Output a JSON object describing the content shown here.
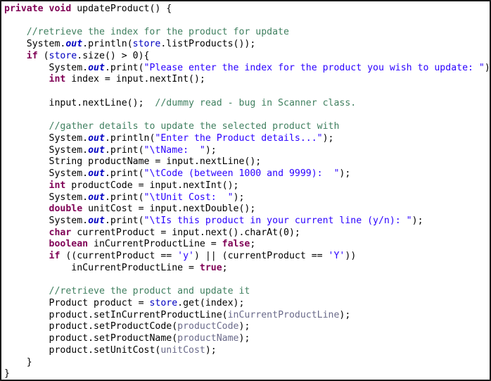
{
  "editor": {
    "title": "Java source code snippet",
    "language": "java",
    "background_color": "#ffffff",
    "border_color": "#1a1a1a",
    "colors": {
      "keyword": "#7f0055",
      "comment": "#3f7f5f",
      "string": "#2a00ff",
      "field": "#0000c0",
      "static_field": "#0000c0",
      "plain": "#000000",
      "argument": "#6a6a8a"
    }
  },
  "code": {
    "lines": [
      {
        "id": "line-1",
        "indent": 0,
        "tokens": [
          {
            "t": "kw",
            "v": "private"
          },
          {
            "t": "pln",
            "v": " "
          },
          {
            "t": "kw",
            "v": "void"
          },
          {
            "t": "pln",
            "v": " updateProduct() {"
          }
        ]
      },
      {
        "id": "line-2",
        "indent": 0,
        "tokens": []
      },
      {
        "id": "line-3",
        "indent": 1,
        "tokens": [
          {
            "t": "cmt",
            "v": "//retrieve the index for the product for update"
          }
        ]
      },
      {
        "id": "line-4",
        "indent": 1,
        "tokens": [
          {
            "t": "pln",
            "v": "System."
          },
          {
            "t": "sfld",
            "v": "out"
          },
          {
            "t": "pln",
            "v": ".println("
          },
          {
            "t": "fld",
            "v": "store"
          },
          {
            "t": "pln",
            "v": ".listProducts());"
          }
        ]
      },
      {
        "id": "line-5",
        "indent": 1,
        "tokens": [
          {
            "t": "kw",
            "v": "if"
          },
          {
            "t": "pln",
            "v": " ("
          },
          {
            "t": "fld",
            "v": "store"
          },
          {
            "t": "pln",
            "v": ".size() > 0){"
          }
        ]
      },
      {
        "id": "line-6",
        "indent": 2,
        "tokens": [
          {
            "t": "pln",
            "v": "System."
          },
          {
            "t": "sfld",
            "v": "out"
          },
          {
            "t": "pln",
            "v": ".print("
          },
          {
            "t": "str",
            "v": "\"Please enter the index for the product you wish to update: \""
          },
          {
            "t": "pln",
            "v": ");"
          }
        ]
      },
      {
        "id": "line-7",
        "indent": 2,
        "tokens": [
          {
            "t": "kw",
            "v": "int"
          },
          {
            "t": "pln",
            "v": " index = input.nextInt();"
          }
        ]
      },
      {
        "id": "line-8",
        "indent": 0,
        "tokens": []
      },
      {
        "id": "line-9",
        "indent": 2,
        "tokens": [
          {
            "t": "pln",
            "v": "input.nextLine();  "
          },
          {
            "t": "cmt",
            "v": "//dummy read - bug in Scanner class."
          }
        ]
      },
      {
        "id": "line-10",
        "indent": 0,
        "tokens": []
      },
      {
        "id": "line-11",
        "indent": 2,
        "tokens": [
          {
            "t": "cmt",
            "v": "//gather details to update the selected product with"
          }
        ]
      },
      {
        "id": "line-12",
        "indent": 2,
        "tokens": [
          {
            "t": "pln",
            "v": "System."
          },
          {
            "t": "sfld",
            "v": "out"
          },
          {
            "t": "pln",
            "v": ".println("
          },
          {
            "t": "str",
            "v": "\"Enter the Product details...\""
          },
          {
            "t": "pln",
            "v": ");"
          }
        ]
      },
      {
        "id": "line-13",
        "indent": 2,
        "tokens": [
          {
            "t": "pln",
            "v": "System."
          },
          {
            "t": "sfld",
            "v": "out"
          },
          {
            "t": "pln",
            "v": ".print("
          },
          {
            "t": "str",
            "v": "\"\\tName:  \""
          },
          {
            "t": "pln",
            "v": ");"
          }
        ]
      },
      {
        "id": "line-14",
        "indent": 2,
        "tokens": [
          {
            "t": "typ",
            "v": "String"
          },
          {
            "t": "pln",
            "v": " productName = input.nextLine();"
          }
        ]
      },
      {
        "id": "line-15",
        "indent": 2,
        "tokens": [
          {
            "t": "pln",
            "v": "System."
          },
          {
            "t": "sfld",
            "v": "out"
          },
          {
            "t": "pln",
            "v": ".print("
          },
          {
            "t": "str",
            "v": "\"\\tCode (between 1000 and 9999):  \""
          },
          {
            "t": "pln",
            "v": ");"
          }
        ]
      },
      {
        "id": "line-16",
        "indent": 2,
        "tokens": [
          {
            "t": "kw",
            "v": "int"
          },
          {
            "t": "pln",
            "v": " productCode = input.nextInt();"
          }
        ]
      },
      {
        "id": "line-17",
        "indent": 2,
        "tokens": [
          {
            "t": "pln",
            "v": "System."
          },
          {
            "t": "sfld",
            "v": "out"
          },
          {
            "t": "pln",
            "v": ".print("
          },
          {
            "t": "str",
            "v": "\"\\tUnit Cost:  \""
          },
          {
            "t": "pln",
            "v": ");"
          }
        ]
      },
      {
        "id": "line-18",
        "indent": 2,
        "tokens": [
          {
            "t": "kw",
            "v": "double"
          },
          {
            "t": "pln",
            "v": " unitCost = input.nextDouble();"
          }
        ]
      },
      {
        "id": "line-19",
        "indent": 2,
        "tokens": [
          {
            "t": "pln",
            "v": "System."
          },
          {
            "t": "sfld",
            "v": "out"
          },
          {
            "t": "pln",
            "v": ".print("
          },
          {
            "t": "str",
            "v": "\"\\tIs this product in your current line (y/n): \""
          },
          {
            "t": "pln",
            "v": ");"
          }
        ]
      },
      {
        "id": "line-20",
        "indent": 2,
        "tokens": [
          {
            "t": "kw",
            "v": "char"
          },
          {
            "t": "pln",
            "v": " currentProduct = input.next().charAt(0);"
          }
        ]
      },
      {
        "id": "line-21",
        "indent": 2,
        "tokens": [
          {
            "t": "kw",
            "v": "boolean"
          },
          {
            "t": "pln",
            "v": " inCurrentProductLine = "
          },
          {
            "t": "kw",
            "v": "false"
          },
          {
            "t": "pln",
            "v": ";"
          }
        ]
      },
      {
        "id": "line-22",
        "indent": 2,
        "tokens": [
          {
            "t": "kw",
            "v": "if"
          },
          {
            "t": "pln",
            "v": " ((currentProduct == "
          },
          {
            "t": "str",
            "v": "'y'"
          },
          {
            "t": "pln",
            "v": ") || (currentProduct == "
          },
          {
            "t": "str",
            "v": "'Y'"
          },
          {
            "t": "pln",
            "v": "))"
          }
        ]
      },
      {
        "id": "line-23",
        "indent": 3,
        "tokens": [
          {
            "t": "pln",
            "v": "inCurrentProductLine = "
          },
          {
            "t": "kw",
            "v": "true"
          },
          {
            "t": "pln",
            "v": ";"
          }
        ]
      },
      {
        "id": "line-24",
        "indent": 0,
        "tokens": []
      },
      {
        "id": "line-25",
        "indent": 2,
        "tokens": [
          {
            "t": "cmt",
            "v": "//retrieve the product and update it"
          }
        ]
      },
      {
        "id": "line-26",
        "indent": 2,
        "tokens": [
          {
            "t": "typ",
            "v": "Product"
          },
          {
            "t": "pln",
            "v": " product = "
          },
          {
            "t": "fld",
            "v": "store"
          },
          {
            "t": "pln",
            "v": ".get(index);"
          }
        ]
      },
      {
        "id": "line-27",
        "indent": 2,
        "tokens": [
          {
            "t": "pln",
            "v": "product.setInCurrentProductLine("
          },
          {
            "t": "arg",
            "v": "inCurrentProductLine"
          },
          {
            "t": "pln",
            "v": ");"
          }
        ]
      },
      {
        "id": "line-28",
        "indent": 2,
        "tokens": [
          {
            "t": "pln",
            "v": "product.setProductCode("
          },
          {
            "t": "arg",
            "v": "productCode"
          },
          {
            "t": "pln",
            "v": ");"
          }
        ]
      },
      {
        "id": "line-29",
        "indent": 2,
        "tokens": [
          {
            "t": "pln",
            "v": "product.setProductName("
          },
          {
            "t": "arg",
            "v": "productName"
          },
          {
            "t": "pln",
            "v": ");"
          }
        ]
      },
      {
        "id": "line-30",
        "indent": 2,
        "tokens": [
          {
            "t": "pln",
            "v": "product.setUnitCost("
          },
          {
            "t": "arg",
            "v": "unitCost"
          },
          {
            "t": "pln",
            "v": ");"
          }
        ]
      },
      {
        "id": "line-31",
        "indent": 1,
        "tokens": [
          {
            "t": "pln",
            "v": "}"
          }
        ]
      },
      {
        "id": "line-32",
        "indent": 0,
        "tokens": [
          {
            "t": "pln",
            "v": "}"
          }
        ]
      }
    ],
    "indent_unit": "    "
  }
}
